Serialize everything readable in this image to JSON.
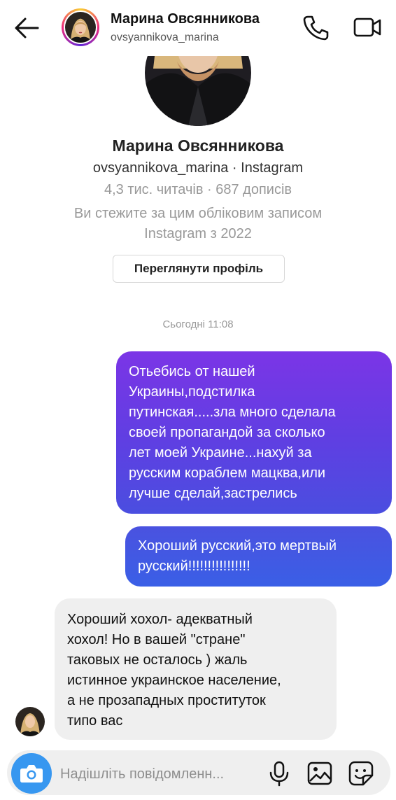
{
  "header": {
    "name": "Марина Овсянникова",
    "username": "ovsyannikova_marina",
    "back_icon": "arrow-left-icon",
    "call_icon": "phone-icon",
    "video_icon": "video-camera-icon"
  },
  "profile": {
    "name": "Марина Овсянникова",
    "handle_line": "ovsyannikova_marina · Instagram",
    "stats": "4,3 тис. читачів · 687 дописів",
    "follow_line1": "Ви стежите за цим обліковим записом",
    "follow_line2": "Instagram з 2022",
    "view_profile_label": "Переглянути профіль"
  },
  "timestamp": "Сьогодні 11:08",
  "messages": [
    {
      "side": "outgoing",
      "lines": [
        "Отьебись от нашей",
        "Украины,подстилка",
        "путинская.....зла много сделала",
        "своей пропагандой за сколько",
        "лет моей Украине...нахуй за",
        "русским кораблем мацква,или",
        "лучше сделай,застрелись"
      ]
    },
    {
      "side": "outgoing",
      "lines": [
        "Хороший русский,это мертвый",
        "русский!!!!!!!!!!!!!!!!"
      ]
    },
    {
      "side": "incoming",
      "lines": [
        "Хороший хохол- адекватный",
        "хохол! Но в вашей \"стране\"",
        "таковых не осталось ) жаль",
        "истинное украинское население,",
        "а не прозападных проституток",
        "типо вас"
      ]
    }
  ],
  "composer": {
    "placeholder": "Надішліть повідомленн...",
    "camera_icon": "camera-icon",
    "mic_icon": "microphone-icon",
    "gallery_icon": "gallery-icon",
    "sticker_icon": "sticker-icon"
  },
  "colors": {
    "outgoing_top": "#7b35e6",
    "outgoing_bottom": "#3a5fe6",
    "incoming_bg": "#efefef",
    "accent_blue": "#3797f0"
  }
}
